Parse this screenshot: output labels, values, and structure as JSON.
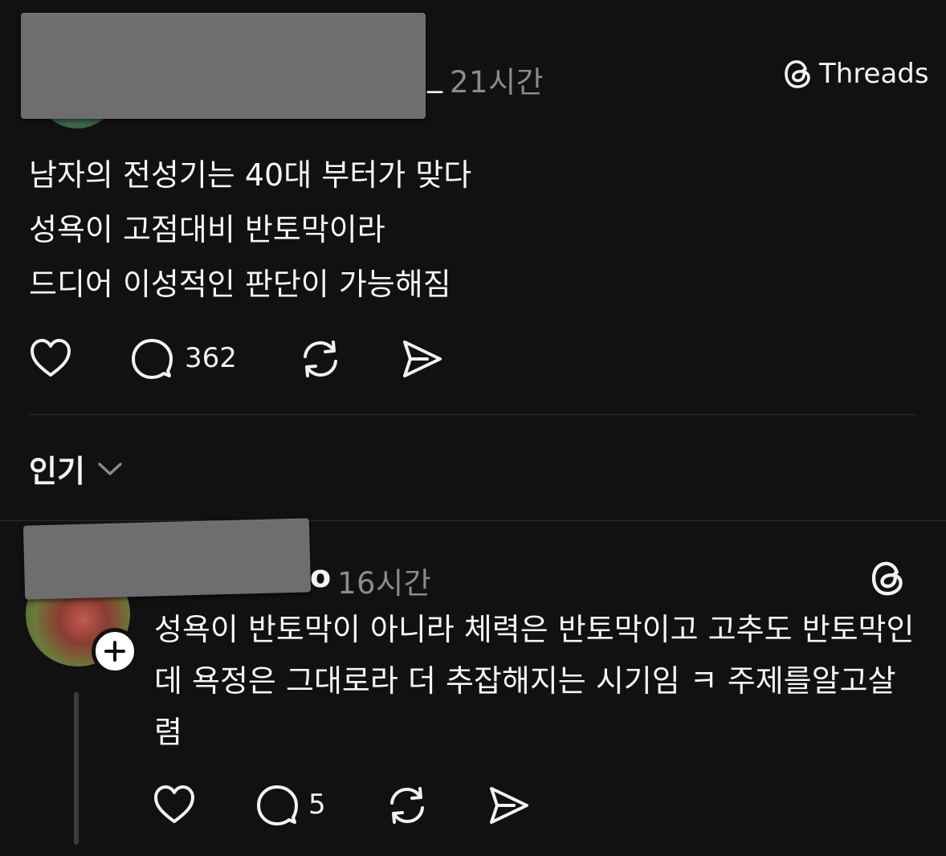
{
  "post": {
    "username_suffix": "_",
    "time": "21시간",
    "brand_label": "Threads",
    "lines": [
      "남자의 전성기는 40대 부터가 맞다",
      "성욕이 고점대비 반토막이라",
      "드디어 이성적인 판단이 가능해짐"
    ],
    "reply_count": "362",
    "icons": {
      "like": "heart-icon",
      "comment": "comment-icon",
      "repost": "repost-icon",
      "share": "share-icon"
    }
  },
  "sort": {
    "label": "인기",
    "icon": "chevron-down-icon"
  },
  "reply": {
    "username_suffix": "o",
    "time": "16시간",
    "text": "성욕이 반토막이 아니라 체력은 반토막이고 고추도 반토막인데 욕정은 그대로라 더 추잡해지는 시기임 ㅋ 주제를알고살렴",
    "reply_count": "5",
    "icons": {
      "like": "heart-icon",
      "comment": "comment-icon",
      "repost": "repost-icon",
      "share": "share-icon",
      "follow": "plus-icon"
    }
  },
  "colors": {
    "background": "#111112",
    "text": "#f5f5f5",
    "muted": "#8b8b8f",
    "divider": "#2d2d30",
    "redaction": "#6e6e70"
  }
}
